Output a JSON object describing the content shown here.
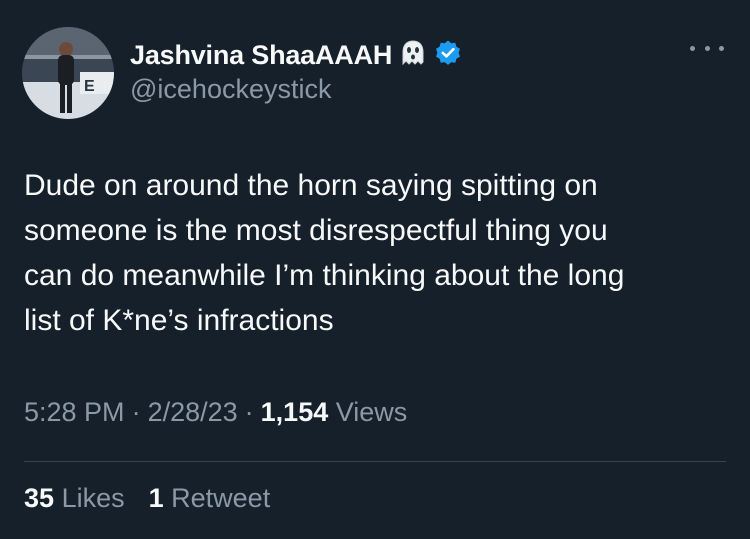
{
  "tweet": {
    "author": {
      "display_name": "Jashvina ShaaAAAH",
      "handle": "@icehockeystick",
      "badge_emoji": "ghost-icon",
      "verified_icon": "verified-badge-icon",
      "verified_color": "#1d9bf0"
    },
    "text": "Dude on around the horn saying spitting on\nsomeone is the most disrespectful thing you\ncan do meanwhile I’m thinking about the long\nlist of K*ne’s infractions",
    "time": "5:28 PM",
    "date": "2/28/23",
    "separator": "·",
    "views_count": "1,154",
    "views_label": "Views",
    "likes_count": "35",
    "likes_label": "Likes",
    "retweets_count": "1",
    "retweets_label": "Retweet"
  },
  "theme": {
    "background": "#15202b",
    "primary_text": "#f7f9f9",
    "secondary_text": "#8b98a5",
    "divider": "#38444d"
  }
}
